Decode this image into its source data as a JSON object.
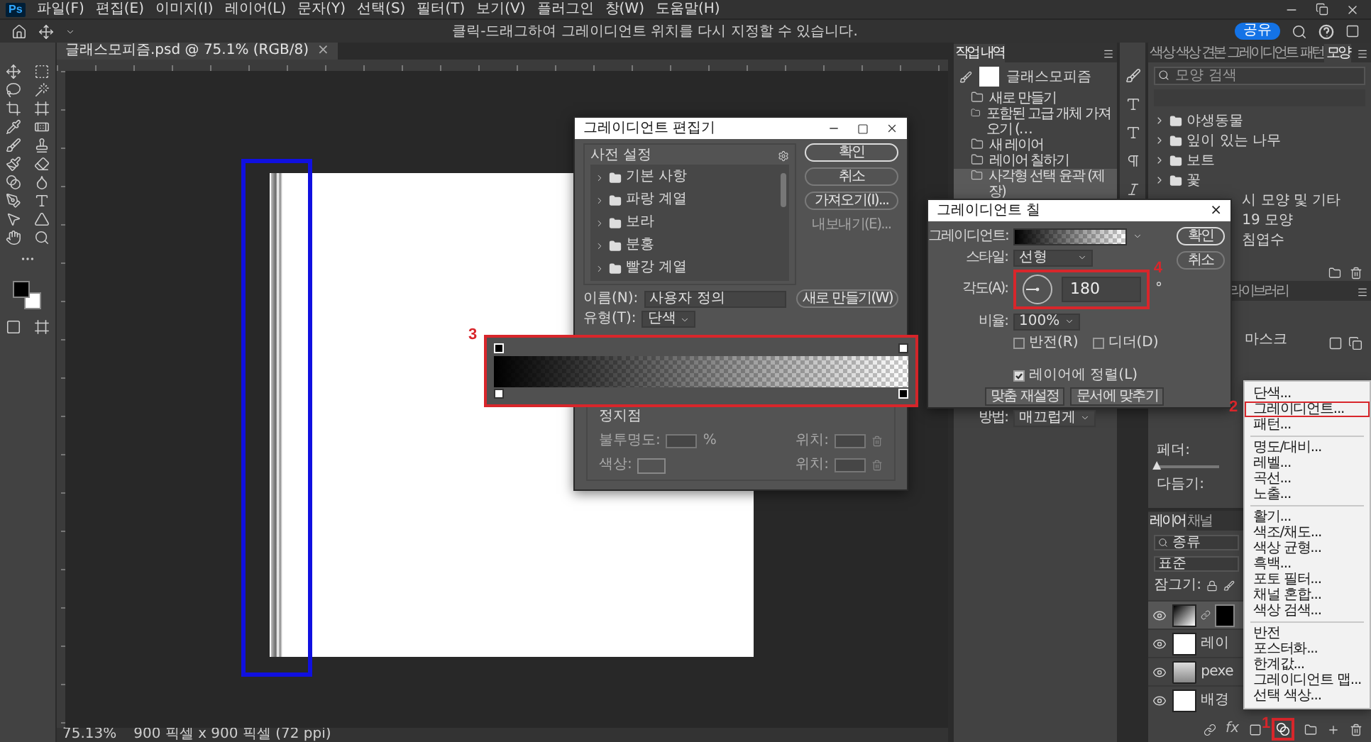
{
  "app_logo": "Ps",
  "menu_bar": [
    "파일(F)",
    "편집(E)",
    "이미지(I)",
    "레이어(L)",
    "문자(Y)",
    "선택(S)",
    "필터(T)",
    "보기(V)",
    "플러그인",
    "창(W)",
    "도움말(H)"
  ],
  "options_bar": {
    "hint": "클릭-드래그하여 그레이디언트 위치를 다시 지정할 수 있습니다.",
    "share_button": "공유"
  },
  "document_tab": {
    "title": "글래스모피즘.psd @ 75.1% (RGB/8)",
    "close": "×"
  },
  "history_panel": {
    "tab": "작업 내역",
    "snapshot": "글래스모피즘",
    "items": [
      {
        "label": "새로 만들기",
        "selected": false
      },
      {
        "label": "포함된 고급 개체 가져오기 (…",
        "selected": false
      },
      {
        "label": "새 레이어",
        "selected": false
      },
      {
        "label": "레이어 칠하기",
        "selected": false
      },
      {
        "label": "사각형 선택 윤곽 (제장)",
        "selected": true
      }
    ]
  },
  "shapes_panel": {
    "tabs": [
      {
        "label": "색상",
        "selected": false
      },
      {
        "label": "색상 견본",
        "selected": false
      },
      {
        "label": "그레이디언트",
        "selected": false
      },
      {
        "label": "패턴",
        "selected": false
      },
      {
        "label": "모양",
        "selected": true
      }
    ],
    "search": {
      "placeholder": "모양 검색"
    },
    "items": [
      {
        "label": "야생동물",
        "kind": "folder"
      },
      {
        "label": "잎이 있는 나무",
        "kind": "folder"
      },
      {
        "label": "보트",
        "kind": "folder"
      },
      {
        "label": "꽃",
        "kind": "folder"
      },
      {
        "label": "시 모양 및 기타",
        "kind": "cut"
      },
      {
        "label": "19 모양",
        "kind": "cut"
      },
      {
        "label": "침엽수",
        "kind": "cut"
      }
    ]
  },
  "library_panel": {
    "tab": "라이브러리"
  },
  "properties_panel": {
    "mask_label": "마스크",
    "feather": {
      "label": "페더:",
      "level": 0
    },
    "refine_label": "다듬기:"
  },
  "layers_panel": {
    "tabs": [
      {
        "label": "레이어",
        "selected": true
      },
      {
        "label": "채널",
        "selected": false
      }
    ],
    "filter": "종류",
    "blend_mode": "표준",
    "lock_label": "잠그기:",
    "layers": [
      {
        "kind": "gradient-fill",
        "visible": true,
        "selected": true
      },
      {
        "kind": "plain",
        "name": "레이",
        "visible": true,
        "selected": false
      },
      {
        "kind": "smart-object",
        "name": "pexe",
        "visible": true,
        "selected": false
      },
      {
        "kind": "plain",
        "name": "배경",
        "visible": true,
        "selected": false
      }
    ],
    "footer_fx": "fx"
  },
  "status_bar": {
    "zoom": "75.13%",
    "document_size": "900 픽셀 x 900 픽셀 (72 ppi)"
  },
  "gradient_editor": {
    "title": "그레이디언트 편집기",
    "presets_label": "사전 설정",
    "presets": [
      "기본 사항",
      "파랑 계열",
      "보라",
      "분홍",
      "빨강 계열"
    ],
    "buttons": [
      {
        "label": "확인",
        "kind": "primary",
        "disabled": false
      },
      {
        "label": "취소",
        "kind": "normal",
        "disabled": false
      },
      {
        "label": "가져오기(I)...",
        "kind": "normal",
        "disabled": false
      },
      {
        "label": "내보내기(E)...",
        "kind": "normal",
        "disabled": true
      }
    ],
    "name_label": "이름(N):",
    "name_value": "사용자 정의",
    "new_button": "새로 만들기(W)",
    "type_label": "유형(T):",
    "type_value": "단색",
    "stops_label": "정지점",
    "stops_disabled": true,
    "stops_rows": [
      {
        "label": "불투명도:",
        "kind": "number",
        "unit": "%",
        "position_label": "위치:"
      },
      {
        "label": "색상:",
        "kind": "color",
        "position_label": "위치:"
      }
    ]
  },
  "gradient_fill": {
    "title": "그레이디언트 칠",
    "close": "×",
    "gradient_label": "그레이디언트:",
    "style_label": "스타일:",
    "style_value": "선형",
    "angle_label": "각도(A):",
    "angle_value": "180",
    "angle_unit": "°",
    "scale_label": "비율:",
    "scale_value": "100%",
    "options": [
      {
        "label": "반전(R)",
        "checked": false
      },
      {
        "label": "디더(D)",
        "checked": false
      },
      {
        "label": "레이어에 정렬(L)",
        "checked": true
      }
    ],
    "buttons": [
      "맞춤 재설정",
      "문서에 맞추기"
    ],
    "method_label": "방법:",
    "method_value": "매끄럽게",
    "ok_button": "확인",
    "cancel_button": "취소"
  },
  "adjustment_menu": {
    "groups": [
      [
        {
          "label": "단색...",
          "marked": false
        },
        {
          "label": "그레이디언트...",
          "marked": true
        },
        {
          "label": "패턴...",
          "marked": false
        }
      ],
      [
        {
          "label": "명도/대비...",
          "marked": false
        },
        {
          "label": "레벨...",
          "marked": false
        },
        {
          "label": "곡선...",
          "marked": false
        },
        {
          "label": "노출...",
          "marked": false
        }
      ],
      [
        {
          "label": "활기...",
          "marked": false
        },
        {
          "label": "색조/채도...",
          "marked": false
        },
        {
          "label": "색상 균형...",
          "marked": false
        },
        {
          "label": "흑백...",
          "marked": false
        },
        {
          "label": "포토 필터...",
          "marked": false
        },
        {
          "label": "채널 혼합...",
          "marked": false
        },
        {
          "label": "색상 검색...",
          "marked": false
        }
      ],
      [
        {
          "label": "반전",
          "marked": false
        },
        {
          "label": "포스터화...",
          "marked": false
        },
        {
          "label": "한계값...",
          "marked": false
        },
        {
          "label": "그레이디언트 맵...",
          "marked": false
        },
        {
          "label": "선택 색상...",
          "marked": false
        }
      ]
    ]
  },
  "annotations": {
    "adjust_icon": "1",
    "menu_item": "2",
    "gradient_bar": "3",
    "angle": "4"
  }
}
